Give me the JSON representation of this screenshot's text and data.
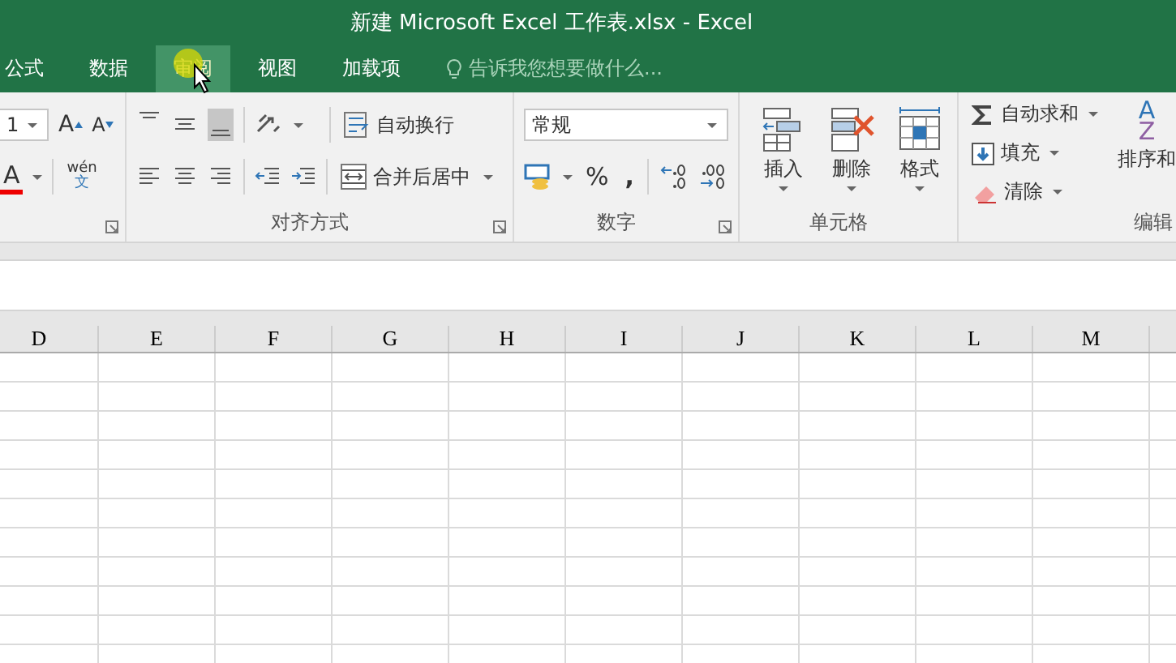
{
  "window": {
    "title": "新建 Microsoft Excel 工作表.xlsx - Excel"
  },
  "tabs": [
    {
      "label": "公式",
      "selected": false
    },
    {
      "label": "数据",
      "selected": false
    },
    {
      "label": "审阅",
      "selected": true
    },
    {
      "label": "视图",
      "selected": false
    },
    {
      "label": "加载项",
      "selected": false
    }
  ],
  "tell_me": {
    "placeholder": "告诉我您想要做什么..."
  },
  "font_group": {
    "size": "1",
    "grow": "A",
    "shrink": "A",
    "font_color": "A",
    "phonetic_top": "wén",
    "phonetic_bottom": "文",
    "launcher": true
  },
  "alignment_group": {
    "label": "对齐方式",
    "vertical_align": [
      {
        "selected": false
      },
      {
        "selected": false
      },
      {
        "selected": true
      }
    ],
    "wrap_text": "自动换行",
    "merge": "合并后居中",
    "launcher": true
  },
  "number_group": {
    "label": "数字",
    "format": "常规",
    "percent": "%",
    "comma": ",",
    "launcher": true
  },
  "cells_group": {
    "label": "单元格",
    "buttons": [
      "插入",
      "删除",
      "格式"
    ]
  },
  "editing_group": {
    "label": "编辑",
    "items": [
      "自动求和",
      "填充",
      "清除"
    ],
    "sort": "排序和",
    "sort_icon_top": "A",
    "sort_icon_bottom": "Z"
  },
  "columns": [
    "D",
    "E",
    "F",
    "G",
    "H",
    "I",
    "J",
    "K",
    "L",
    "M"
  ]
}
